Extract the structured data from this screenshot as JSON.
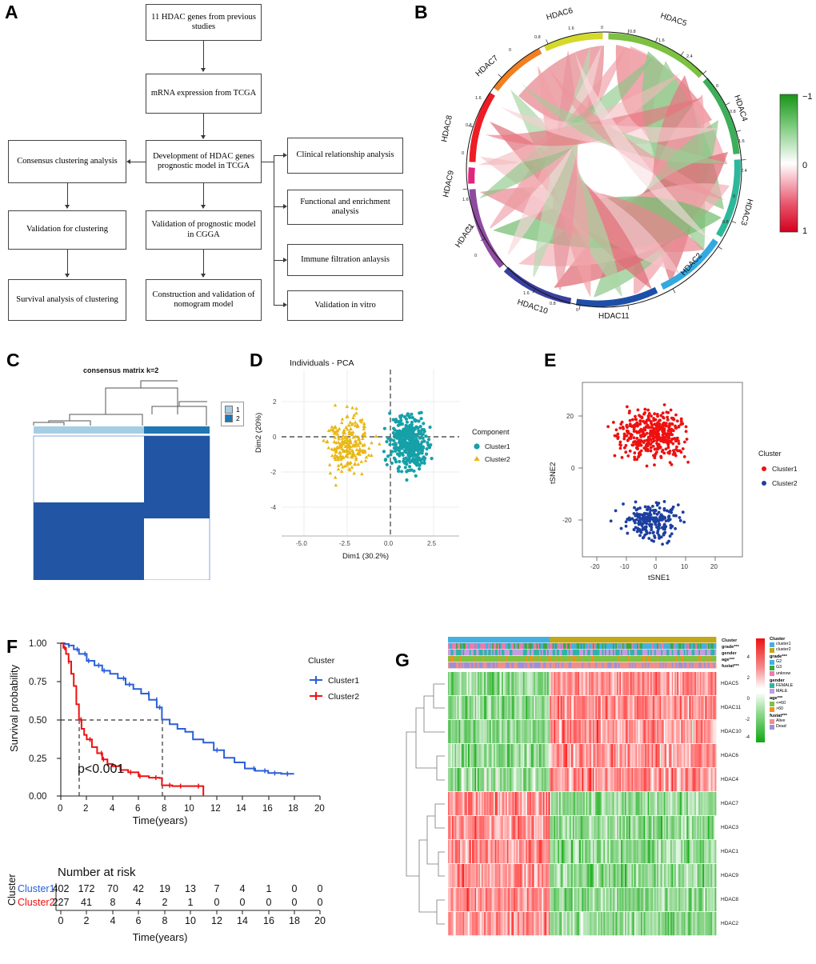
{
  "panels": {
    "a": "A",
    "b": "B",
    "c": "C",
    "d": "D",
    "e": "E",
    "f": "F",
    "g": "G"
  },
  "flowchart": {
    "boxes": [
      {
        "id": "n1",
        "text": "11 HDAC genes from previous studies"
      },
      {
        "id": "n2",
        "text": "mRNA expression from TCGA"
      },
      {
        "id": "n3",
        "text": "Development of HDAC genes prognostic model in TCGA"
      },
      {
        "id": "n4",
        "text": "Consensus clustering analysis"
      },
      {
        "id": "n5",
        "text": "Validation for clustering"
      },
      {
        "id": "n6",
        "text": "Survival analysis of clustering"
      },
      {
        "id": "n7",
        "text": "Validation of prognostic model in CGGA"
      },
      {
        "id": "n8",
        "text": "Construction and validation of nomogram model"
      },
      {
        "id": "n9",
        "text": "Clinical relationship analysis"
      },
      {
        "id": "n10",
        "text": "Functional and enrichment analysis"
      },
      {
        "id": "n11",
        "text": "Immune filtration anlaysis"
      },
      {
        "id": "n12",
        "text": "Validation in vitro"
      }
    ]
  },
  "circos": {
    "genes": [
      "HDAC5",
      "HDAC4",
      "HDAC3",
      "HDAC2",
      "HDAC11",
      "HDAC10",
      "HDAC1",
      "HDAC9",
      "HDAC8",
      "HDAC7",
      "HDAC6"
    ],
    "axis_ticks": [
      "0",
      "0.8",
      "1.6",
      "2.4"
    ],
    "legend": {
      "top": "−1",
      "mid": "0",
      "bottom": "1",
      "color_high": "#22aa33",
      "color_low": "#dd0022"
    }
  },
  "consensus": {
    "title": "consensus matrix k=2",
    "legend_items": [
      {
        "label": "1",
        "color": "#a6cee3"
      },
      {
        "label": "2",
        "color": "#1f78b4"
      }
    ],
    "matrix_color": "#2255a4"
  },
  "chart_data": [
    {
      "type": "scatter",
      "panel": "D",
      "title": "Individuals - PCA",
      "xlabel": "Dim1 (30.2%)",
      "ylabel": "Dim2 (20%)",
      "xticks": [
        "-5.0",
        "-2.5",
        "0.0",
        "2.5"
      ],
      "yticks": [
        "-4",
        "-2",
        "0",
        "2"
      ],
      "xlim": [
        -6.2,
        4.2
      ],
      "ylim": [
        -4.8,
        3.8
      ],
      "legend_title": "Component",
      "series": [
        {
          "name": "Cluster1",
          "color": "#16a0a8",
          "marker": "circle",
          "n": 402
        },
        {
          "name": "Cluster2",
          "color": "#e8b816",
          "marker": "triangle",
          "n": 227
        }
      ],
      "grid": true,
      "reference_lines": {
        "x": 0,
        "y": 0
      }
    },
    {
      "type": "scatter",
      "panel": "E",
      "title": "",
      "xlabel": "tSNE1",
      "ylabel": "tSNE2",
      "xticks": [
        "-20",
        "-10",
        "0",
        "10",
        "20"
      ],
      "yticks": [
        "-20",
        "0",
        "20"
      ],
      "xlim": [
        -25,
        28
      ],
      "ylim": [
        -38,
        34
      ],
      "legend_title": "Cluster",
      "series": [
        {
          "name": "Cluster1",
          "color": "#ee1111",
          "marker": "circle"
        },
        {
          "name": "Cluster2",
          "color": "#1d3fa0",
          "marker": "circle"
        }
      ],
      "grid": false
    },
    {
      "type": "line",
      "panel": "F",
      "title": "",
      "xlabel": "Time(years)",
      "ylabel": "Survival probability",
      "xticks": [
        "0",
        "2",
        "4",
        "6",
        "8",
        "10",
        "12",
        "14",
        "16",
        "18",
        "20"
      ],
      "yticks": [
        "0.00",
        "0.25",
        "0.50",
        "0.75",
        "1.00"
      ],
      "xlim": [
        0,
        20
      ],
      "ylim": [
        0,
        1
      ],
      "annotation": "p<0.001",
      "legend_title": "Cluster",
      "median_lines": {
        "y": 0.5,
        "cluster1_x": 7.8,
        "cluster2_x": 1.4
      },
      "series": [
        {
          "name": "Cluster1",
          "color": "#2b5fd9",
          "x": [
            0,
            0.3,
            0.6,
            1.0,
            1.4,
            2.0,
            2.6,
            3.2,
            3.8,
            4.4,
            5.0,
            5.6,
            6.2,
            6.8,
            7.4,
            7.8,
            8.4,
            9.0,
            9.6,
            10.2,
            11.0,
            11.8,
            12.6,
            13.4,
            14.2,
            15.0,
            16.0,
            17.0,
            17.6,
            18.0
          ],
          "y": [
            1.0,
            0.995,
            0.985,
            0.96,
            0.93,
            0.885,
            0.855,
            0.82,
            0.8,
            0.77,
            0.73,
            0.7,
            0.67,
            0.63,
            0.58,
            0.5,
            0.47,
            0.44,
            0.42,
            0.37,
            0.35,
            0.3,
            0.25,
            0.22,
            0.18,
            0.165,
            0.15,
            0.145,
            0.145,
            0.145
          ]
        },
        {
          "name": "Cluster2",
          "color": "#ee1111",
          "x": [
            0,
            0.2,
            0.4,
            0.6,
            0.8,
            1.0,
            1.2,
            1.4,
            1.6,
            1.8,
            2.0,
            2.4,
            2.8,
            3.2,
            3.6,
            4.0,
            4.6,
            5.2,
            6.0,
            6.8,
            7.6,
            7.8,
            8.6,
            9.5,
            10.5,
            11.0
          ],
          "y": [
            1.0,
            0.97,
            0.93,
            0.88,
            0.8,
            0.72,
            0.6,
            0.5,
            0.44,
            0.4,
            0.37,
            0.32,
            0.28,
            0.24,
            0.21,
            0.195,
            0.17,
            0.155,
            0.13,
            0.12,
            0.118,
            0.07,
            0.065,
            0.065,
            0.065,
            0.0
          ]
        }
      ],
      "risk_table": {
        "title": "Number at risk",
        "row_label": "Cluster",
        "x_label": "Time(years)",
        "times": [
          "0",
          "2",
          "4",
          "6",
          "8",
          "10",
          "12",
          "14",
          "16",
          "18",
          "20"
        ],
        "rows": [
          {
            "name": "Cluster1",
            "color": "#2b5fd9",
            "values": [
              "402",
              "172",
              "70",
              "42",
              "19",
              "13",
              "7",
              "4",
              "1",
              "0",
              "0"
            ]
          },
          {
            "name": "Cluster2",
            "color": "#ee1111",
            "values": [
              "227",
              "41",
              "8",
              "4",
              "2",
              "1",
              "0",
              "0",
              "0",
              "0",
              "0"
            ]
          }
        ]
      }
    },
    {
      "type": "heatmap",
      "panel": "G",
      "rows": [
        "HDAC5",
        "HDAC11",
        "HDAC10",
        "HDAC6",
        "HDAC4",
        "HDAC7",
        "HDAC3",
        "HDAC1",
        "HDAC9",
        "HDAC8",
        "HDAC2"
      ],
      "annotation_tracks": [
        "Cluster",
        "grade***",
        "gender",
        "age***",
        "fustat***"
      ],
      "scale_ticks": [
        "4",
        "2",
        "0",
        "-2",
        "-4"
      ],
      "scale_high_color": "#ee1111",
      "scale_low_color": "#22bb22",
      "legend_groups": [
        {
          "title": "Cluster",
          "items": [
            {
              "label": "cluster1",
              "color": "#45b0e0"
            },
            {
              "label": "cluster2",
              "color": "#bfa918"
            }
          ]
        },
        {
          "title": "grade***",
          "items": [
            {
              "label": "G2",
              "color": "#45b0e0"
            },
            {
              "label": "G3",
              "color": "#3aa83a"
            },
            {
              "label": "unknow",
              "color": "#ee7aae"
            }
          ]
        },
        {
          "title": "gender",
          "items": [
            {
              "label": "FEMALE",
              "color": "#2fb3a8"
            },
            {
              "label": "MALE",
              "color": "#c79de0"
            }
          ]
        },
        {
          "title": "age***",
          "items": [
            {
              "label": "<=60",
              "color": "#7fc241"
            },
            {
              "label": ">60",
              "color": "#f2901e"
            }
          ]
        },
        {
          "title": "fustat***",
          "items": [
            {
              "label": "Alive",
              "color": "#f08f8a"
            },
            {
              "label": "Dead",
              "color": "#9f8fd8"
            }
          ]
        }
      ]
    }
  ]
}
